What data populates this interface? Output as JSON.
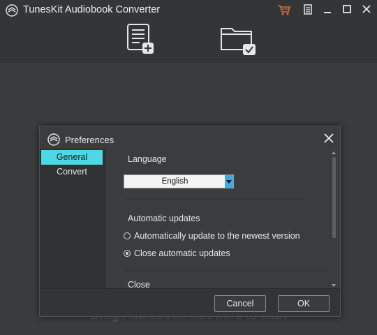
{
  "app": {
    "title": "TunesKit Audiobook Converter",
    "accent_color": "#4dd8e6",
    "cart_color": "#e56a2a"
  },
  "titlebar": {
    "icons": [
      "shopping-cart-icon",
      "menu-icon",
      "minimize-icon",
      "maximize-icon",
      "close-icon"
    ]
  },
  "toolbar": {
    "add_files_icon": "add-files-icon",
    "convert_icon": "convert-folder-icon"
  },
  "main": {
    "drag_hint": "Drag Audiobook files here to start"
  },
  "preferences": {
    "title": "Preferences",
    "nav": [
      {
        "label": "General",
        "selected": true
      },
      {
        "label": "Convert",
        "selected": false
      }
    ],
    "language": {
      "label": "Language",
      "value": "English"
    },
    "updates": {
      "label": "Automatic updates",
      "options": [
        {
          "label": "Automatically update to the newest version",
          "checked": false
        },
        {
          "label": "Close automatic updates",
          "checked": true
        }
      ]
    },
    "close_section": {
      "label": "Close"
    },
    "buttons": {
      "cancel": "Cancel",
      "ok": "OK"
    }
  }
}
